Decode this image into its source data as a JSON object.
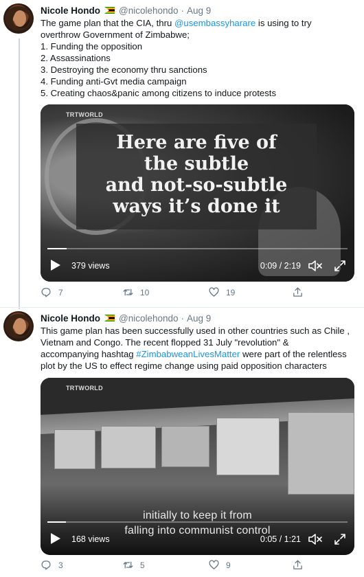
{
  "tweets": [
    {
      "author_name": "Nicole Hondo",
      "handle": "@nicolehondo",
      "separator": "·",
      "date": "Aug 9",
      "text": {
        "l1_pre": "The game plan that the CIA, thru ",
        "l1_mention": "@usembassyharare",
        "l1_post": " is using to try",
        "l2": "overthrow Government of Zimbabwe;",
        "l3": "1. Funding the opposition",
        "l4": "2. Assassinations",
        "l5": "3. Destroying the economy thru sanctions",
        "l6": "4. Funding anti-Gvt media campaign",
        "l7": "5. Creating chaos&panic among citizens to induce protests"
      },
      "video": {
        "logo": "TRTWORLD",
        "caption": [
          "Here are five of",
          "the subtle",
          "and not-so-subtle",
          "ways it’s done it"
        ],
        "views": "379 views",
        "time": "0:09 / 2:19",
        "progress": 0.065
      },
      "replies": "7",
      "retweets": "10",
      "likes": "19"
    },
    {
      "author_name": "Nicole Hondo",
      "handle": "@nicolehondo",
      "separator": "·",
      "date": "Aug 9",
      "text": {
        "l1": "This game plan has been successfully used in other countries such as Chile ,",
        "l2": "Vietnam and Congo. The recent flopped 31 July \"revolution\" &",
        "l3_pre": "accompanying hashtag ",
        "l3_hashtag": "#ZimbabweanLivesMatter",
        "l3_post": " were part of the relentless",
        "l4": "plot by the US to effect regime change using paid opposition characters"
      },
      "video": {
        "logo": "TRTWORLD",
        "subtitle_1": "initially to keep it from",
        "subtitle_2": "falling into communist control",
        "views": "168 views",
        "time": "0:05 / 1:21",
        "progress": 0.062
      },
      "replies": "3",
      "retweets": "5",
      "likes": "9"
    }
  ],
  "colors": {
    "link": "#1b95e0",
    "muted": "#657786",
    "thread_line": "#ccd6dd"
  },
  "icons": [
    "reply-icon",
    "retweet-icon",
    "like-icon",
    "share-icon",
    "play-icon",
    "mute-icon",
    "expand-icon",
    "flag-zimbabwe-icon"
  ]
}
